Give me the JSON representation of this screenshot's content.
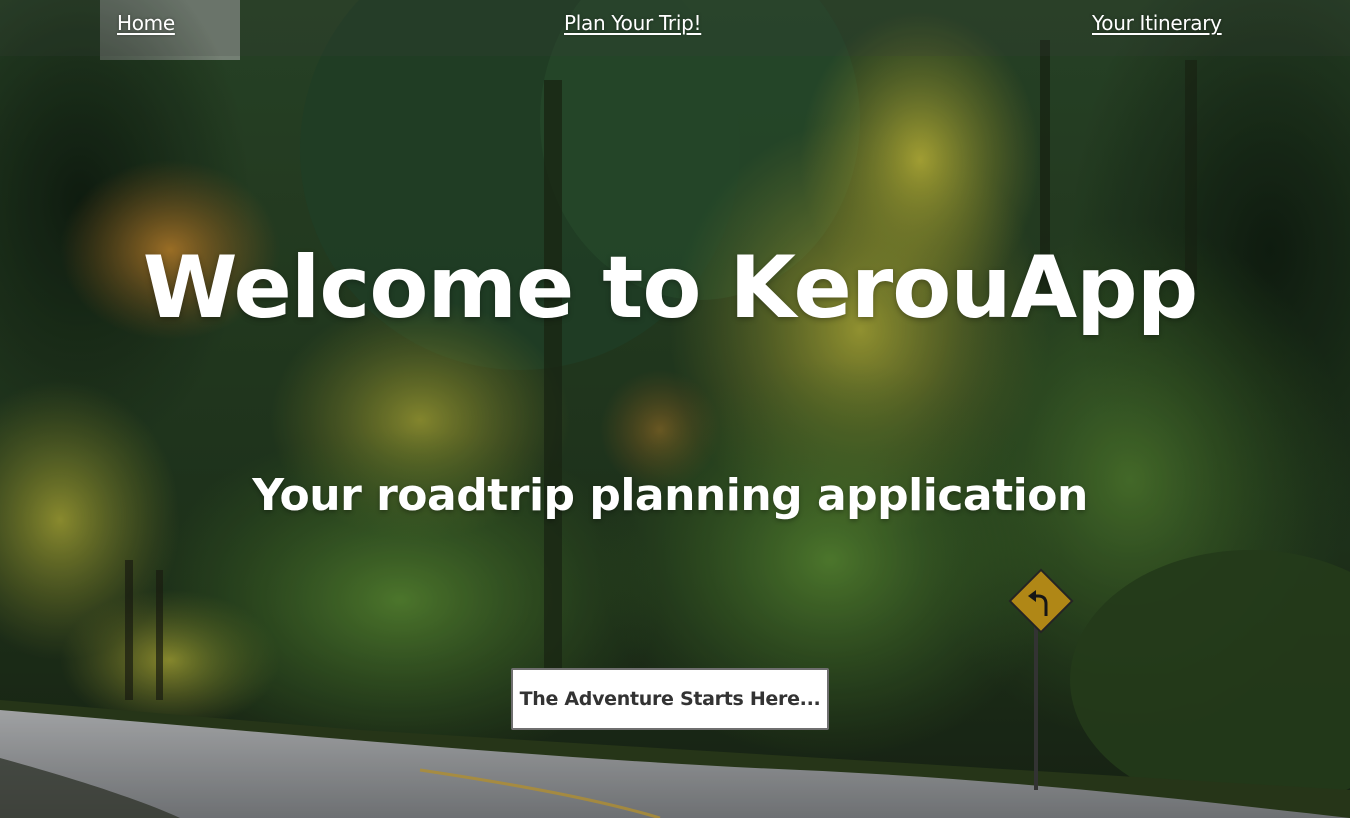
{
  "nav": {
    "items": [
      {
        "label": "Home"
      },
      {
        "label": "Plan Your Trip!"
      },
      {
        "label": "Your Itinerary"
      }
    ]
  },
  "hero": {
    "title": "Welcome to KerouApp",
    "subtitle": "Your roadtrip planning application",
    "cta_label": "The Adventure Starts Here..."
  },
  "background": {
    "scene": "forest-road-photo",
    "colors": {
      "forest_dark": "#1f3a1e",
      "forest_mid": "#3f6b2a",
      "foliage_yellow": "#b9b337",
      "road": "#8a8c8e",
      "sign": "#c99a1a"
    }
  }
}
